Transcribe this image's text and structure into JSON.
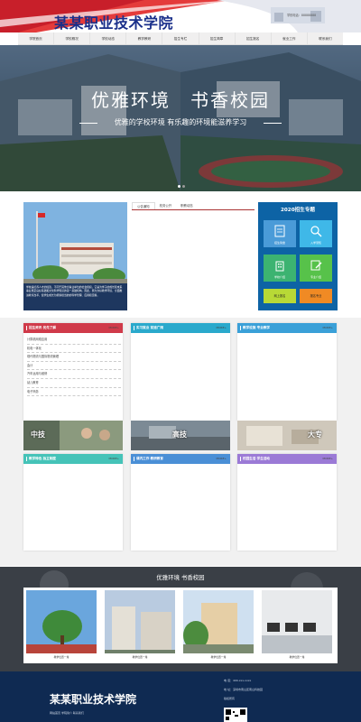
{
  "header": {
    "title": "某某职业技术学院",
    "phone": "学校电话：88888888"
  },
  "nav": {
    "items": [
      "学院首页",
      "学校概况",
      "学校动态",
      "教学教研",
      "招生专栏",
      "招生简章",
      "招生报名",
      "就业工作",
      "联系我们"
    ]
  },
  "banner": {
    "title": "优雅环境　书香校园",
    "subtitle": "优雅的学校环境  有乐趣的环境能滋养学习"
  },
  "intro": {
    "text": "学校是培养人才的摇篮。不同于其他企事业单位的社会组织，它是为学子的成长和未来事业奠定良好基础和文化科学知识的第一基础机构。因此，努力办好教学环境，全面推进教育改革，使学生成长为能够担当的的科学管理、应用和掌握。"
  },
  "news": {
    "tabs": [
      "公告通知",
      "校务公开",
      "职教动态"
    ]
  },
  "enroll": {
    "title": "2020招生专题",
    "tiles": [
      "招生简章",
      "入学须知",
      "学校介绍",
      "专业介绍"
    ],
    "buttons": [
      "网上报名",
      "报名专业"
    ]
  },
  "cards_top": [
    {
      "title": "招生资讯  优先了解",
      "more": "MORE+",
      "color": "#d03a4a"
    },
    {
      "title": "实习就业  前途广阔",
      "more": "MORE+",
      "color": "#2aa9cc"
    },
    {
      "title": "教学设施  专业教学",
      "more": "MORE+",
      "color": "#3aa0d8"
    }
  ],
  "list_items": [
    "计算机网络应用",
    "机电一体化",
    "现代物流与国际物流管理",
    "会计",
    "汽车运用与维修",
    "幼儿教育",
    "电子商务"
  ],
  "photo_labels": [
    "中技",
    "高技",
    "大专"
  ],
  "cards_bottom": [
    {
      "title": "教学特色  独立制度",
      "more": "MORE+",
      "color": "#45c3b8"
    },
    {
      "title": "课内工作  教研教育",
      "more": "MORE+",
      "color": "#4a8fd6"
    },
    {
      "title": "校园生活  学生活动",
      "more": "MORE+",
      "color": "#9b7ad6"
    }
  ],
  "gallery": {
    "title": "优雅环境  书香校园",
    "captions": [
      "教学位置一角",
      "教学位置一角",
      "教学位置一角",
      "教学位置一角"
    ]
  },
  "footer": {
    "title": "某某职业技术学院",
    "phone": "电  话：400-xxx-xxxx",
    "address": "地  址：深圳市南山区南山科技园",
    "links": "网站首页  学院简介  联系我们",
    "copyright": "版权所有"
  },
  "colors": {
    "brand": "#1a2f8a",
    "enroll_bg": "#0d63a5",
    "gallery_bg": "#3a3f46",
    "footer_bg": "#0f2a52"
  }
}
